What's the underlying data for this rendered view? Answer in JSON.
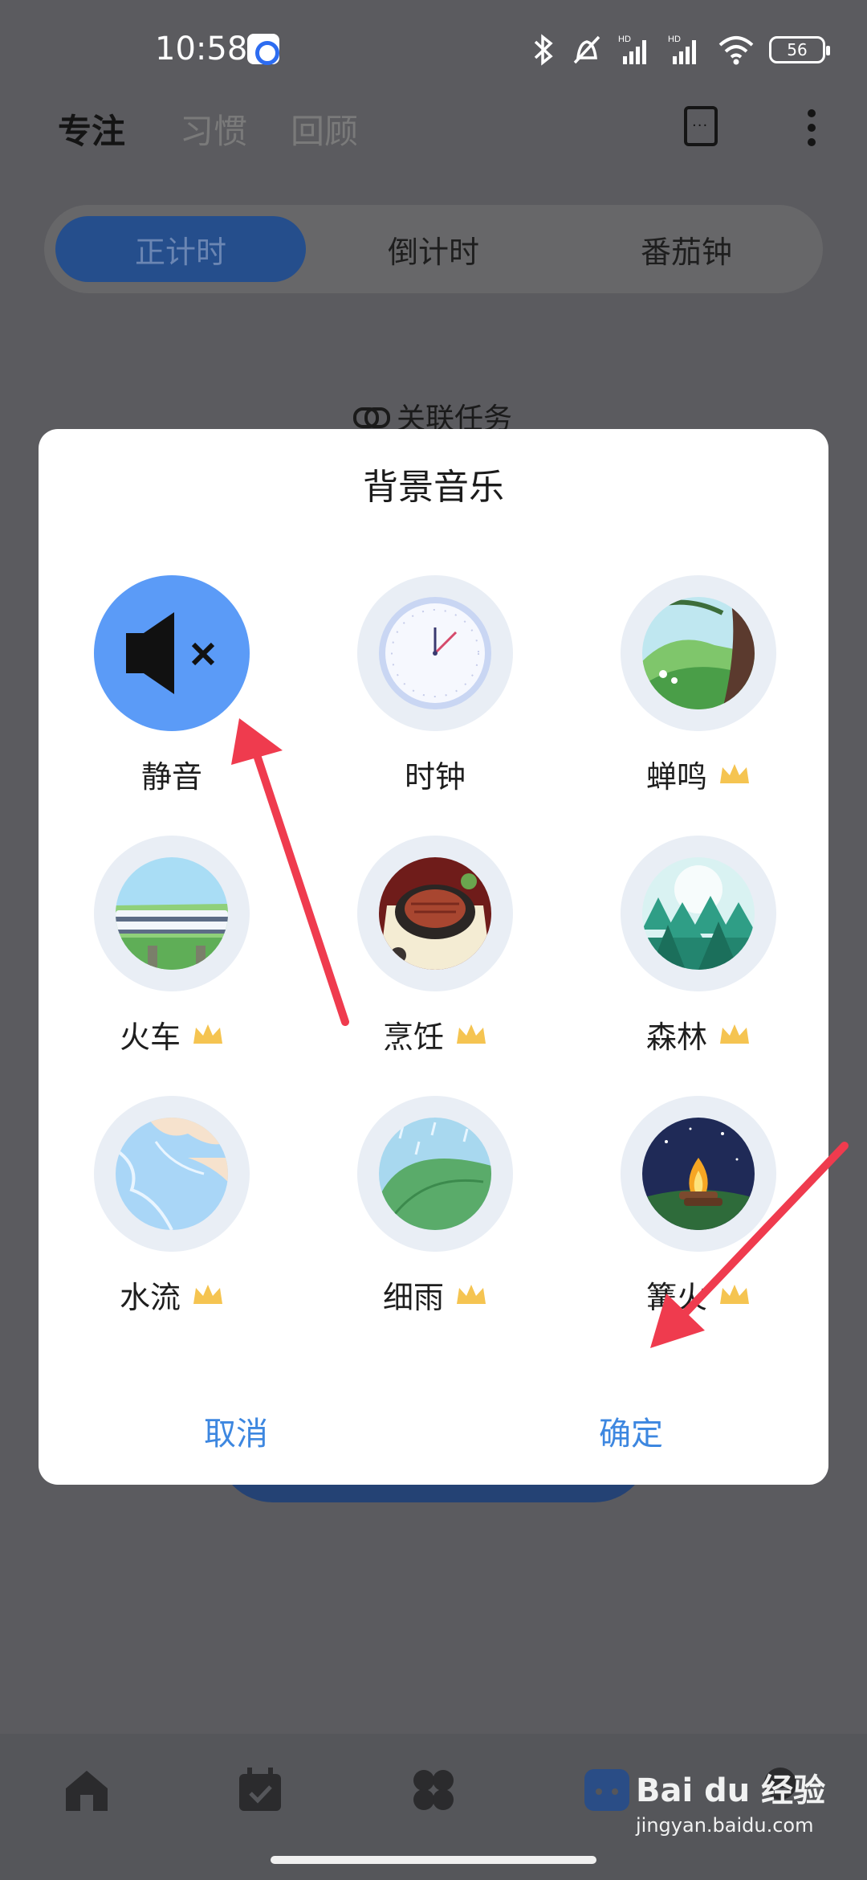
{
  "status": {
    "time": "10:58",
    "battery": "56"
  },
  "header": {
    "tabs": [
      "专注",
      "习惯",
      "回顾"
    ],
    "active_tab": "专注"
  },
  "modes": [
    "正计时",
    "倒计时",
    "番茄钟"
  ],
  "related_task": "关联任务",
  "dialog": {
    "title": "背景音乐",
    "options": [
      {
        "label": "静音",
        "premium": false,
        "selected": true,
        "icon": "mute-icon"
      },
      {
        "label": "时钟",
        "premium": false,
        "selected": false,
        "icon": "clock-icon"
      },
      {
        "label": "蝉鸣",
        "premium": true,
        "selected": false,
        "icon": "cicada-scene-icon"
      },
      {
        "label": "火车",
        "premium": true,
        "selected": false,
        "icon": "train-scene-icon"
      },
      {
        "label": "烹饪",
        "premium": true,
        "selected": false,
        "icon": "cooking-scene-icon"
      },
      {
        "label": "森林",
        "premium": true,
        "selected": false,
        "icon": "forest-scene-icon"
      },
      {
        "label": "水流",
        "premium": true,
        "selected": false,
        "icon": "water-scene-icon"
      },
      {
        "label": "细雨",
        "premium": true,
        "selected": false,
        "icon": "rain-scene-icon"
      },
      {
        "label": "篝火",
        "premium": true,
        "selected": false,
        "icon": "campfire-scene-icon"
      }
    ],
    "cancel_label": "取消",
    "confirm_label": "确定"
  },
  "watermark": {
    "brand": "Bai du 经验",
    "url": "jingyan.baidu.com"
  },
  "colors": {
    "accent": "#3d87e0",
    "selected": "#5b9bf7",
    "arrow": "#ef3b4e",
    "crown": "#f5c451"
  }
}
